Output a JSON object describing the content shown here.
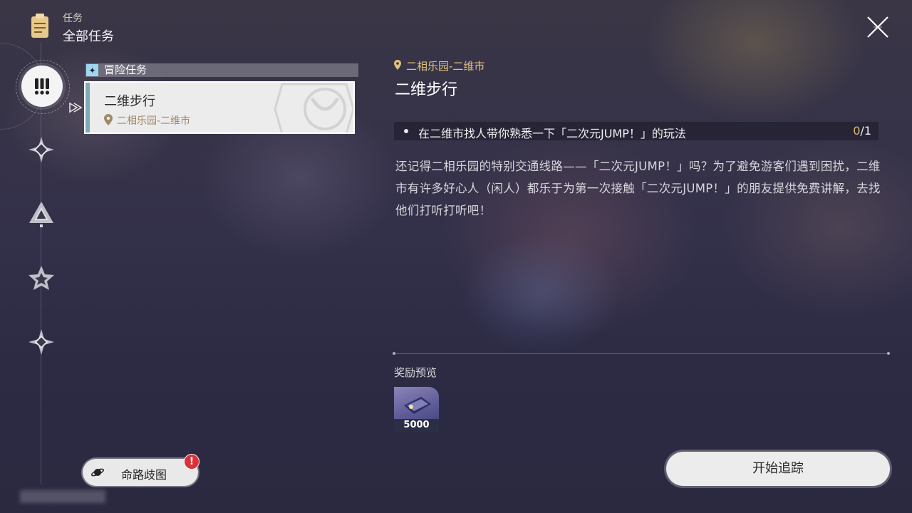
{
  "header": {
    "section": "任务",
    "title": "全部任务"
  },
  "category_rail": [
    {
      "name": "adventure",
      "icon": "exclamation-icon",
      "active": true
    },
    {
      "name": "category-2",
      "icon": "diamond-star-icon"
    },
    {
      "name": "category-3",
      "icon": "triangle-icon"
    },
    {
      "name": "category-4",
      "icon": "star-icon"
    },
    {
      "name": "category-5",
      "icon": "diamond-star-icon"
    }
  ],
  "mission_list": {
    "category_label": "冒险任务",
    "items": [
      {
        "title": "二维步行",
        "location": "二相乐园-二维市",
        "selected": true
      }
    ]
  },
  "detail": {
    "location": "二相乐园-二维市",
    "title": "二维步行",
    "objective": {
      "text": "在二维市找人带你熟悉一下「二次元JUMP！」的玩法",
      "done": "0",
      "total": "/1"
    },
    "description": "还记得二相乐园的特别交通线路——「二次元JUMP！」吗？为了避免游客们遇到困扰，二维市有许多好心人（闲人）都乐于为第一次接触「二次元JUMP！」的朋友提供免费讲解，去找他们打听打听吧！",
    "reward_label": "奖励预览",
    "rewards": [
      {
        "icon": "ticket-icon",
        "quantity": "5000"
      }
    ]
  },
  "buttons": {
    "branch_map": "命路歧图",
    "branch_badge": "!",
    "track": "开始追踪"
  },
  "colors": {
    "accent_gold": "#e0c07a",
    "badge_red": "#d9323a",
    "card_bar": "#7faab6"
  }
}
